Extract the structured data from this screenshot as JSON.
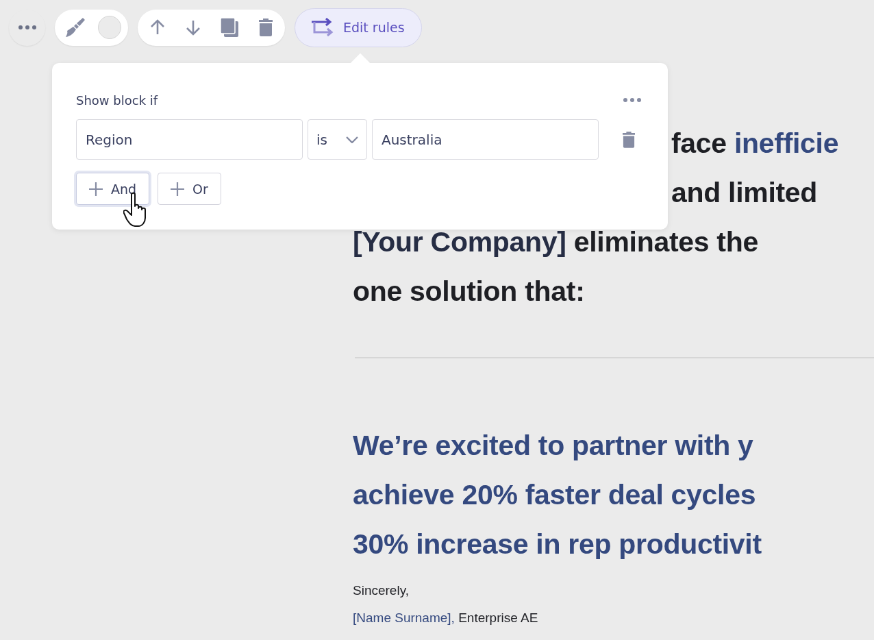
{
  "toolbar": {
    "edit_rules": {
      "label": "Edit rules",
      "selected": true
    }
  },
  "popover": {
    "title": "Show block if",
    "condition": {
      "field": "Region",
      "operator": "is",
      "value": "Australia"
    },
    "buttons": [
      {
        "label": "And",
        "focused": true
      },
      {
        "label": "Or",
        "focused": false
      }
    ]
  },
  "document": {
    "intro_lines": [
      [
        {
          "text": "face ",
          "kind": "plain"
        },
        {
          "text": "inefficie",
          "kind": "highlight"
        }
      ],
      [
        {
          "text": "and limited",
          "kind": "plain"
        }
      ],
      [
        {
          "text": "[Your Company]",
          "kind": "placeholder"
        },
        {
          "text": " eliminates the",
          "kind": "plain"
        }
      ],
      [
        {
          "text": "one solution that:",
          "kind": "plain"
        }
      ]
    ],
    "highlight_lines": [
      "We’re excited to partner with y",
      "achieve 20% faster deal cycles",
      "30% increase in rep productivit"
    ],
    "signoff": "Sincerely,",
    "signature": [
      {
        "text": "[Name Surname],",
        "kind": "placeholder"
      },
      {
        "text": " Enterprise AE",
        "kind": "plain"
      }
    ]
  }
}
